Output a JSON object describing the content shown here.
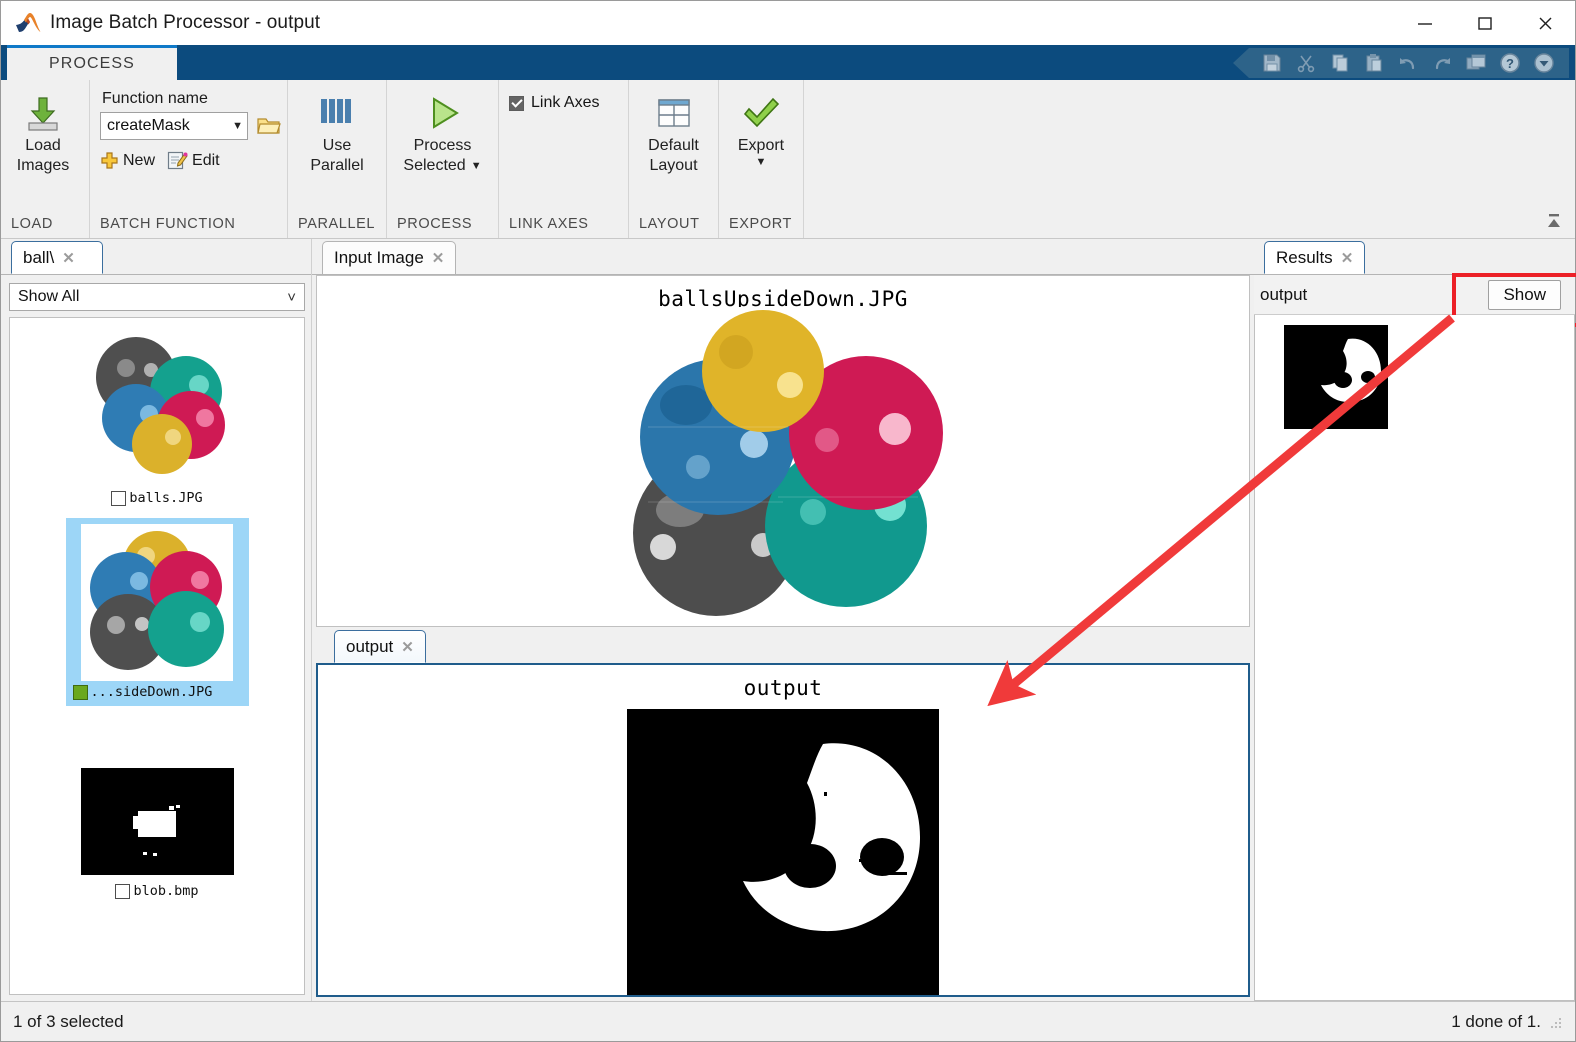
{
  "window": {
    "title": "Image Batch Processor - output",
    "app_icon": "matlab-icon",
    "minimize": "—",
    "maximize": "☐",
    "close": "✕"
  },
  "ribbon": {
    "tab_label": "PROCESS",
    "quick_access": [
      "save-icon",
      "cut-icon",
      "copy-icon",
      "paste-icon",
      "undo-icon",
      "redo-icon",
      "layout-icon",
      "help-icon",
      "dropdown-icon"
    ],
    "minimize_ribbon": "collapse-ribbon-icon",
    "groups": [
      {
        "title": "LOAD",
        "buttons": [
          {
            "label_line1": "Load",
            "label_line2": "Images",
            "icon": "load-images-icon"
          }
        ]
      },
      {
        "title": "BATCH FUNCTION",
        "function_name_label": "Function name",
        "function_name_value": "createMask",
        "function_name_caret": "▼",
        "browse_icon": "open-folder-icon",
        "new_label": "New",
        "new_icon": "plus-icon",
        "edit_label": "Edit",
        "edit_icon": "edit-pencil-icon"
      },
      {
        "title": "PARALLEL",
        "buttons": [
          {
            "label_line1": "Use",
            "label_line2": "Parallel",
            "icon": "parallel-bars-icon"
          }
        ]
      },
      {
        "title": "PROCESS",
        "buttons": [
          {
            "label_line1": "Process",
            "label_line2": "Selected",
            "icon": "play-triangle-icon",
            "caret": "▼"
          }
        ]
      },
      {
        "title": "LINK AXES",
        "checkbox_label": "Link Axes",
        "checkbox_checked": true
      },
      {
        "title": "LAYOUT",
        "buttons": [
          {
            "label_line1": "Default",
            "label_line2": "Layout",
            "icon": "default-layout-icon"
          }
        ]
      },
      {
        "title": "EXPORT",
        "buttons": [
          {
            "label_line1": "Export",
            "label_line2": "",
            "icon": "green-check-icon",
            "caret": "▼"
          }
        ]
      }
    ]
  },
  "left_panel": {
    "tab_label": "ball\\",
    "tab_close": "✕",
    "filter_value": "Show All",
    "filter_caret": "˅",
    "items": [
      {
        "name": "balls.JPG",
        "checked": false,
        "selected": false,
        "thumb": "balls-photo"
      },
      {
        "name": "...sideDown.JPG",
        "checked": true,
        "selected": true,
        "thumb": "balls-upside-down-photo"
      },
      {
        "name": "blob.bmp",
        "checked": false,
        "selected": false,
        "thumb": "blob-mask"
      }
    ]
  },
  "center_panel": {
    "input_tab": {
      "label": "Input Image",
      "close": "✕",
      "active": false
    },
    "input_axes_title": "ballsUpsideDown.JPG",
    "output_tab": {
      "label": "output",
      "close": "✕",
      "active": true
    },
    "output_axes_title": "output"
  },
  "right_panel": {
    "tab_label": "Results",
    "tab_close": "✕",
    "result_name": "output",
    "show_button": "Show",
    "annotation_color": "#ec2027"
  },
  "status_bar": {
    "left": "1 of 3 selected",
    "right": "1 done of 1.",
    "grip": "resize-grip"
  },
  "colors": {
    "ribbon_tab_strip": "#0c4b7e",
    "ribbon_bg": "#f0f0f0",
    "accent_blue": "#0f79c8",
    "selection_blue": "#9dd6f7",
    "annotation_red": "#ec2027",
    "ball_yellow": "#e0b429",
    "ball_blue": "#2b76ab",
    "ball_pink": "#cf1a54",
    "ball_teal": "#11998e",
    "ball_gray": "#4a4a4a"
  }
}
